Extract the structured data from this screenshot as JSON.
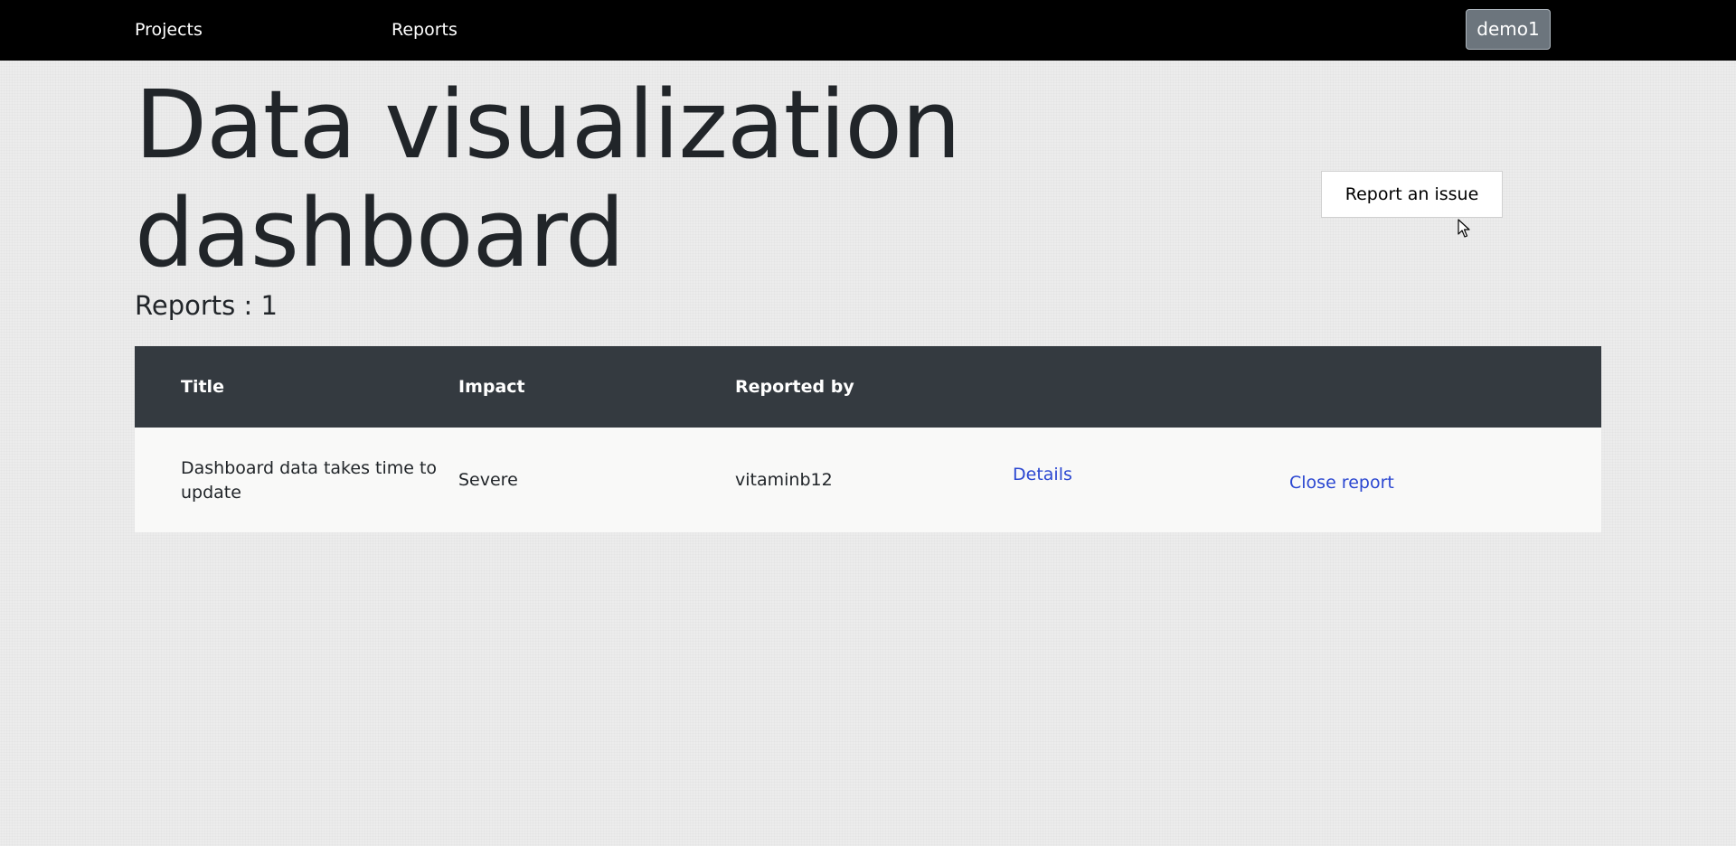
{
  "nav": {
    "projects_label": "Projects",
    "reports_label": "Reports",
    "user_label": "demo1"
  },
  "page": {
    "title": "Data visualization dashboard",
    "report_count": "Reports : 1",
    "report_issue_label": "Report an issue"
  },
  "table": {
    "headers": [
      "Title",
      "Impact",
      "Reported by"
    ],
    "rows": [
      {
        "title": "Dashboard data takes time to update",
        "impact": "Severe",
        "reported_by": "vitaminb12",
        "details_label": "Details",
        "close_label": "Close report"
      }
    ]
  },
  "colors": {
    "nav_background": "#000000",
    "table_header": "#343a40",
    "link": "#2b47d1",
    "user_button": "#6c757d"
  },
  "icons": {
    "cursor": "mouse-pointer-icon"
  }
}
